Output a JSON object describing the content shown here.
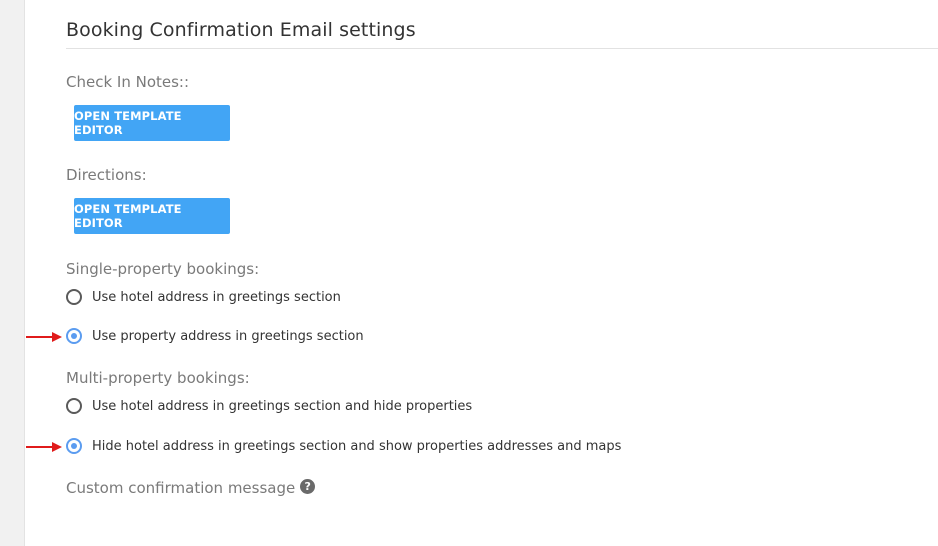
{
  "section": {
    "title": "Booking Confirmation Email settings"
  },
  "check_in_notes": {
    "label": "Check In Notes::",
    "button_label": "OPEN TEMPLATE EDITOR"
  },
  "directions": {
    "label": "Directions:",
    "button_label": "OPEN TEMPLATE EDITOR"
  },
  "single_property": {
    "label": "Single-property bookings:",
    "options": [
      {
        "label": "Use hotel address in greetings section",
        "selected": false
      },
      {
        "label": "Use property address in greetings section",
        "selected": true
      }
    ]
  },
  "multi_property": {
    "label": "Multi-property bookings:",
    "options": [
      {
        "label": "Use hotel address in greetings section and hide properties",
        "selected": false
      },
      {
        "label": "Hide hotel address in greetings section and show properties addresses and maps",
        "selected": true
      }
    ]
  },
  "custom_message": {
    "label": "Custom confirmation message",
    "help_glyph": "?"
  },
  "colors": {
    "button_bg": "#42a5f5",
    "radio_checked": "#5b9cf0",
    "annotation_arrow": "#e01b1b"
  }
}
